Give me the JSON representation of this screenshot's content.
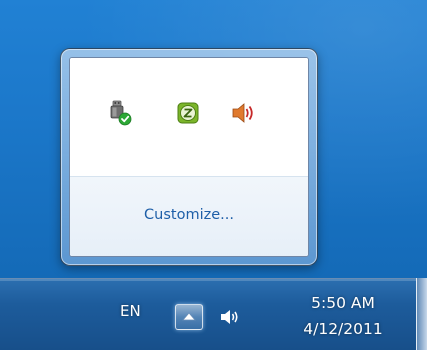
{
  "notification_overflow": {
    "icons": [
      {
        "name": "safely-remove-hardware-icon"
      },
      {
        "name": "z-app-icon"
      },
      {
        "name": "speaker-icon"
      }
    ],
    "customize_label": "Customize..."
  },
  "taskbar": {
    "language": "EN",
    "show_hidden_icons": "up-arrow-icon",
    "volume_icon": "speaker-icon",
    "time": "5:50 AM",
    "date": "4/12/2011"
  },
  "colors": {
    "desktop": "#1b77c9",
    "taskbar": "#1d5c9c",
    "link": "#1e5fa8"
  }
}
